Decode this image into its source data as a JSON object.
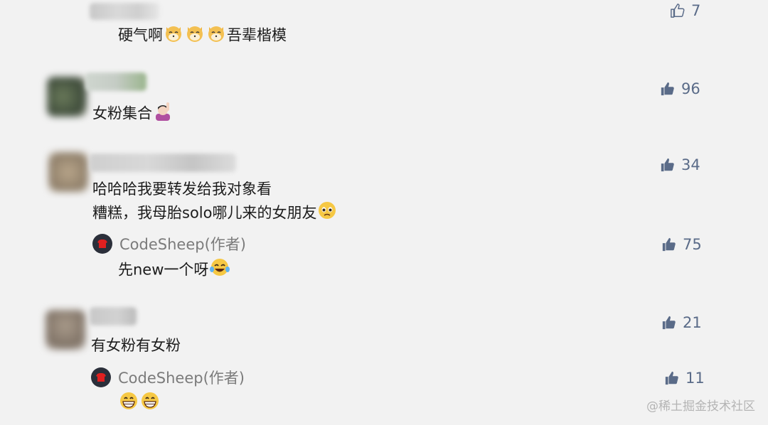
{
  "comments": [
    {
      "text": "硬气啊",
      "suffix": "吾辈楷模",
      "likes": "7"
    },
    {
      "text": "女粉集合",
      "likes": "96"
    },
    {
      "line1": "哈哈哈我要转发给我对象看",
      "line2": "糟糕，我母胎solo哪儿来的女朋友",
      "likes": "34",
      "reply": {
        "author": "CodeSheep(作者)",
        "text": "先new一个呀",
        "likes": "75"
      }
    },
    {
      "text": "有女粉有女粉",
      "likes": "21",
      "reply": {
        "author": "CodeSheep(作者)",
        "likes": "11"
      }
    }
  ],
  "watermark": "@稀土掘金技术社区",
  "colors": {
    "like": "#5a6b88",
    "author_name": "#7b7b7b",
    "author_avatar": "#2b2f3a",
    "avatar_logo": "#e02020"
  },
  "icons": [
    "thumbs-up-outline-icon",
    "thumbs-up-filled-icon",
    "cat-face-emoji",
    "raising-hand-emoji",
    "pleading-face-emoji",
    "tears-of-joy-emoji",
    "grinning-face-emoji"
  ]
}
